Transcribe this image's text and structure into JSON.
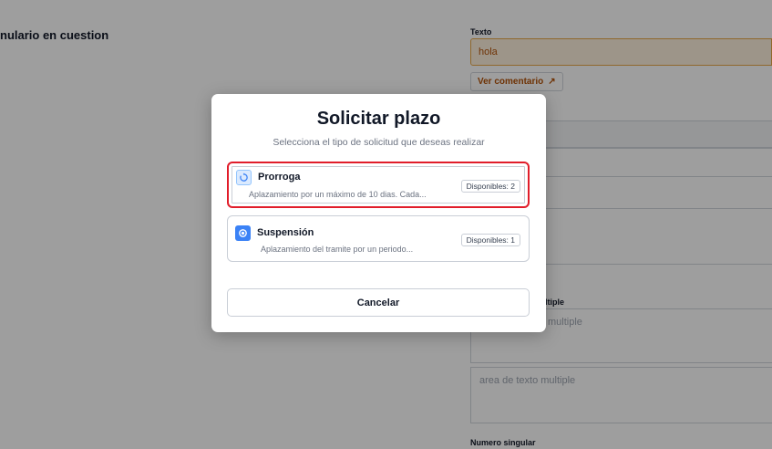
{
  "background": {
    "form_title": "nulario en cuestion",
    "texto_label": "Texto",
    "texto_value": "hola",
    "ver_comentario": "Ver comentario",
    "ver_arrow": "↗",
    "multiple_label": "ltiple",
    "textarea1_placeholder": "multiple",
    "textarea2_placeholder": "area de texto multiple",
    "numero_label": "Numero singular"
  },
  "modal": {
    "title": "Solicitar plazo",
    "subtitle": "Selecciona el tipo de solicitud que deseas realizar",
    "options": [
      {
        "title": "Prorroga",
        "description": "Aplazamiento por un máximo de 10 dias. Cada...",
        "badge": "Disponibles: 2",
        "icon": "refresh-icon",
        "selected": true
      },
      {
        "title": "Suspensión",
        "description": "Aplazamiento del tramite por un periodo...",
        "badge": "Disponibles: 1",
        "icon": "radio-dot-icon",
        "selected": false
      }
    ],
    "cancel_label": "Cancelar"
  },
  "colors": {
    "accent": "#3b82f6",
    "selected_border": "#e11d2a",
    "input_highlight": "#fdf0dd"
  }
}
